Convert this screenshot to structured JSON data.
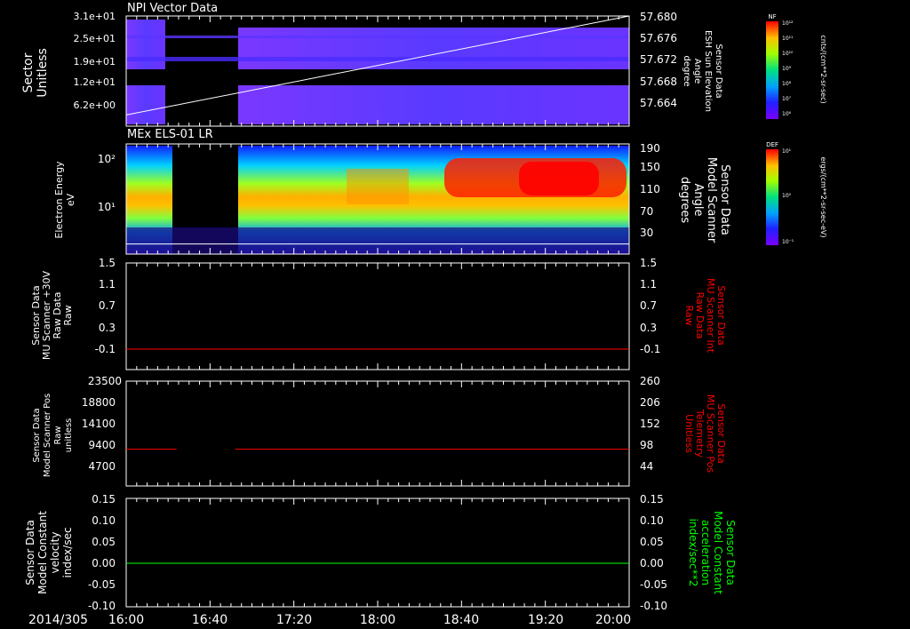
{
  "date_label": "2014/305",
  "time_ticks": [
    "16:00",
    "16:40",
    "17:20",
    "18:00",
    "18:40",
    "19:20",
    "20:00"
  ],
  "colors": {
    "background": "#000000",
    "axis": "#ffffff",
    "red_series": "#ff0000",
    "green_series": "#00ff00"
  },
  "panels": [
    {
      "id": "npi",
      "title": "NPI Vector Data",
      "ylabel_left": [
        "Sector",
        "Unitless"
      ],
      "left_ticks": [
        "3.1e+01",
        "2.5e+01",
        "1.9e+01",
        "1.2e+01",
        "6.2e+00"
      ],
      "right_ticks": [
        "57.680",
        "57.676",
        "57.672",
        "57.668",
        "57.664"
      ],
      "ylabel_right": [
        "Sensor Data",
        "ESH Sun Elevation",
        "Angle",
        "degree"
      ],
      "colorbar": {
        "tag": "NF",
        "unit": "cnts/(cm**2-sr-sec)",
        "ticks": [
          "10¹²",
          "10¹¹",
          "10¹⁰",
          "10⁹",
          "10⁸",
          "10⁷",
          "10⁶"
        ]
      }
    },
    {
      "id": "els",
      "title": "MEx ELS-01 LR",
      "ylabel_left": [
        "Electron Energy",
        "eV"
      ],
      "left_ticks": [
        "10²",
        "10¹"
      ],
      "right_ticks": [
        "190",
        "150",
        "110",
        "70",
        "30"
      ],
      "ylabel_right": [
        "Sensor Data",
        "Model Scanner",
        "Angle",
        "degrees"
      ],
      "colorbar": {
        "tag": "DEF",
        "unit": "ergs/(cm**2-sr-sec-eV)",
        "ticks": [
          "10¹",
          "10⁰",
          "10⁻¹"
        ]
      }
    },
    {
      "id": "mu30",
      "ylabel_left": [
        "Sensor Data",
        "MU Scanner +30V",
        "Raw Data",
        "Raw"
      ],
      "left_ticks": [
        "1.5",
        "1.1",
        "0.7",
        "0.3",
        "-0.1"
      ],
      "right_ticks": [
        "1.5",
        "1.1",
        "0.7",
        "0.3",
        "-0.1"
      ],
      "ylabel_right": [
        "Sensor Data",
        "MU Scanner Int",
        "Raw Data",
        "Raw"
      ]
    },
    {
      "id": "scanpos",
      "ylabel_left": [
        "Sensor Data",
        "Model Scanner Pos",
        "Raw",
        "unitless"
      ],
      "left_ticks": [
        "23500",
        "18800",
        "14100",
        "9400",
        "4700"
      ],
      "right_ticks": [
        "260",
        "206",
        "152",
        "98",
        "44"
      ],
      "ylabel_right": [
        "Sensor Data",
        "MU Scanner Pos",
        "Telemetry",
        "Unitless"
      ]
    },
    {
      "id": "velocity",
      "ylabel_left": [
        "Sensor Data",
        "Model Constant",
        "velocity",
        "index/sec"
      ],
      "left_ticks": [
        "0.15",
        "0.10",
        "0.05",
        "0.00",
        "-0.05",
        "-0.10"
      ],
      "right_ticks": [
        "0.15",
        "0.10",
        "0.05",
        "0.00",
        "-0.05",
        "-0.10"
      ],
      "ylabel_right": [
        "Sensor Data",
        "Model Constant",
        "acceleration",
        "index/sec**2"
      ]
    }
  ],
  "chart_data": [
    {
      "type": "heatmap",
      "title": "NPI Vector Data",
      "x_range": [
        "16:00",
        "20:00"
      ],
      "data_gap": [
        "16:24",
        "16:52"
      ],
      "y_ticks": [
        31,
        25,
        19,
        12,
        6.2
      ],
      "line_series": {
        "axis": "right",
        "x": [
          "16:00",
          "20:00"
        ],
        "y": [
          57.662,
          57.68
        ]
      }
    },
    {
      "type": "heatmap",
      "title": "MEx ELS-01 LR",
      "x_range": [
        "16:00",
        "20:00"
      ],
      "data_gap": [
        "16:28",
        "16:52"
      ],
      "y_scale": "log",
      "y_ticks": [
        100,
        10
      ],
      "right_ticks": [
        190,
        150,
        110,
        70,
        30
      ],
      "line_series": {
        "axis": "right",
        "x": [
          "16:00",
          "20:00"
        ],
        "y": [
          9,
          9
        ]
      }
    },
    {
      "type": "line",
      "x_range": [
        "16:00",
        "20:00"
      ],
      "ylim": [
        -0.35,
        1.5
      ],
      "series": [
        {
          "x": [
            "16:00",
            "20:00"
          ],
          "y": [
            -0.1,
            -0.1
          ]
        }
      ]
    },
    {
      "type": "line",
      "x_range": [
        "16:00",
        "20:00"
      ],
      "ylim": [
        0,
        23500
      ],
      "series": [
        {
          "x": [
            "16:00",
            "16:24"
          ],
          "y": [
            8500,
            8500
          ]
        },
        {
          "x": [
            "16:52",
            "20:00"
          ],
          "y": [
            8500,
            8500
          ]
        }
      ]
    },
    {
      "type": "line",
      "x_range": [
        "16:00",
        "20:00"
      ],
      "ylim": [
        -0.1,
        0.15
      ],
      "series": [
        {
          "x": [
            "16:00",
            "20:00"
          ],
          "y": [
            0.0,
            0.0
          ]
        }
      ]
    }
  ]
}
